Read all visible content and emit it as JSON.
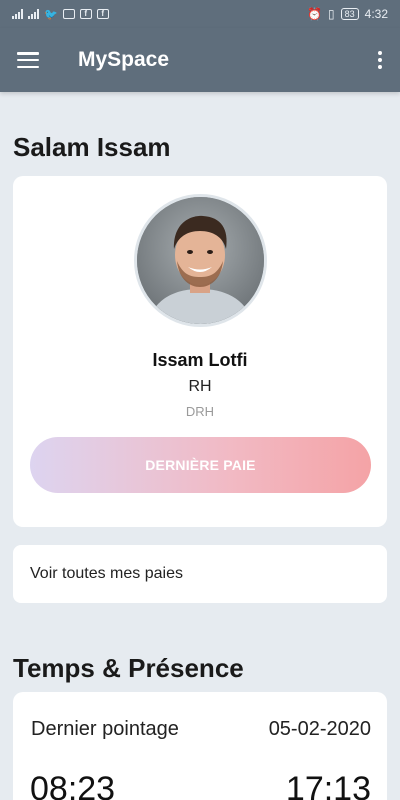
{
  "status_bar": {
    "time": "4:32",
    "battery": "83",
    "notification_icons": [
      "twitter-icon",
      "image-icon",
      "facebook-icon",
      "facebook-icon"
    ]
  },
  "app_bar": {
    "title": "MySpace"
  },
  "greeting": "Salam Issam",
  "profile": {
    "name": "Issam Lotfi",
    "role": "RH",
    "department": "DRH",
    "last_pay_button": "DERNIÈRE PAIE"
  },
  "pays": {
    "view_all": "Voir toutes mes paies"
  },
  "attendance": {
    "section_title": "Temps & Présence",
    "last_clock_label": "Dernier pointage",
    "last_clock_date": "05-02-2020",
    "clock_in": "08:23",
    "clock_out": "17:13"
  },
  "colors": {
    "app_bar": "#5f6e7c",
    "background": "#e6ebf0",
    "button_gradient_start": "#ddd4f0",
    "button_gradient_end": "#f4a3a6"
  }
}
